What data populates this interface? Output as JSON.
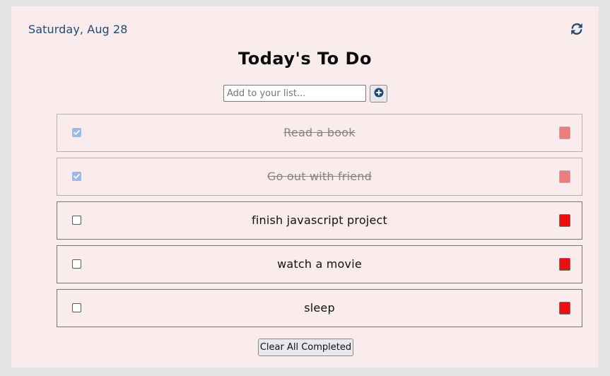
{
  "header": {
    "date": "Saturday, Aug 28",
    "title": "Today's To Do",
    "refresh_icon": "refresh-icon"
  },
  "add": {
    "placeholder": "Add to your list...",
    "value": "",
    "button_icon": "plus-circle-icon"
  },
  "todos": [
    {
      "label": "Read a book",
      "completed": true
    },
    {
      "label": "Go out with friend",
      "completed": true
    },
    {
      "label": "finish javascript project",
      "completed": false
    },
    {
      "label": "watch a movie",
      "completed": false
    },
    {
      "label": "sleep",
      "completed": false
    }
  ],
  "footer": {
    "clear_label": "Clear All Completed"
  },
  "colors": {
    "card_background": "#faecec",
    "date_text": "#1f4b74",
    "delete_active": "#ee0c0c",
    "delete_completed": "#f07b7b",
    "checkbox_checked": "#9bbbe6"
  }
}
